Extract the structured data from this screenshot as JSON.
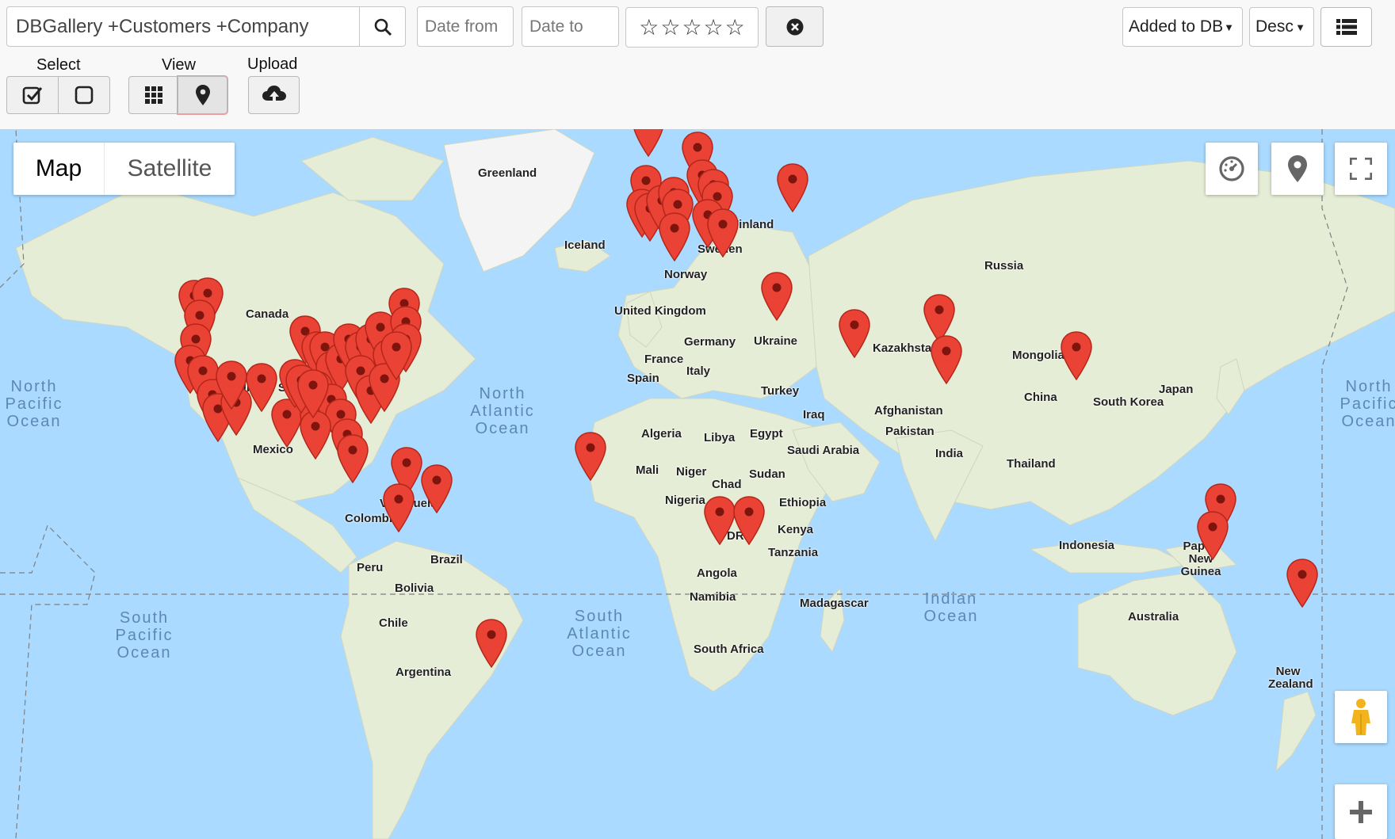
{
  "search": {
    "value": "DBGallery +Customers +Company"
  },
  "filters": {
    "date_from_placeholder": "Date from",
    "date_to_placeholder": "Date to",
    "stars": [
      "☆",
      "☆",
      "☆",
      "☆",
      "☆"
    ]
  },
  "sort": {
    "field": "Added to DB",
    "order": "Desc"
  },
  "toolbar": {
    "select_label": "Select",
    "view_label": "View",
    "upload_label": "Upload"
  },
  "map": {
    "map_type_map": "Map",
    "map_type_satellite": "Satellite",
    "places": [
      "Greenland",
      "Iceland",
      "Finland",
      "Sweden",
      "Norway",
      "United Kingdom",
      "Germany",
      "France",
      "Spain",
      "Italy",
      "Ukraine",
      "Russia",
      "Kazakhstan",
      "Mongolia",
      "China",
      "Japan",
      "South Korea",
      "Turkey",
      "Iraq",
      "Afghanistan",
      "Pakistan",
      "India",
      "Thailand",
      "Algeria",
      "Libya",
      "Egypt",
      "Saudi Arabia",
      "Mali",
      "Niger",
      "Chad",
      "Sudan",
      "Nigeria",
      "Ethiopia",
      "DRC",
      "Kenya",
      "Tanzania",
      "Angola",
      "Namibia",
      "South Africa",
      "Madagascar",
      "Canada",
      "United States",
      "Mexico",
      "Venezuela",
      "Colombia",
      "Brazil",
      "Peru",
      "Bolivia",
      "Chile",
      "Argentina",
      "Indonesia",
      "Papua New Guinea",
      "Australia",
      "New Zealand"
    ],
    "oceans": [
      "North Atlantic Ocean",
      "South Atlantic Ocean",
      "Indian Ocean",
      "North Pacific Ocean",
      "South Pacific Ocean",
      "North Pacific Ocean"
    ]
  },
  "colors": {
    "marker": "#ea4335",
    "water": "#aadaff",
    "land": "#e8eed8"
  }
}
